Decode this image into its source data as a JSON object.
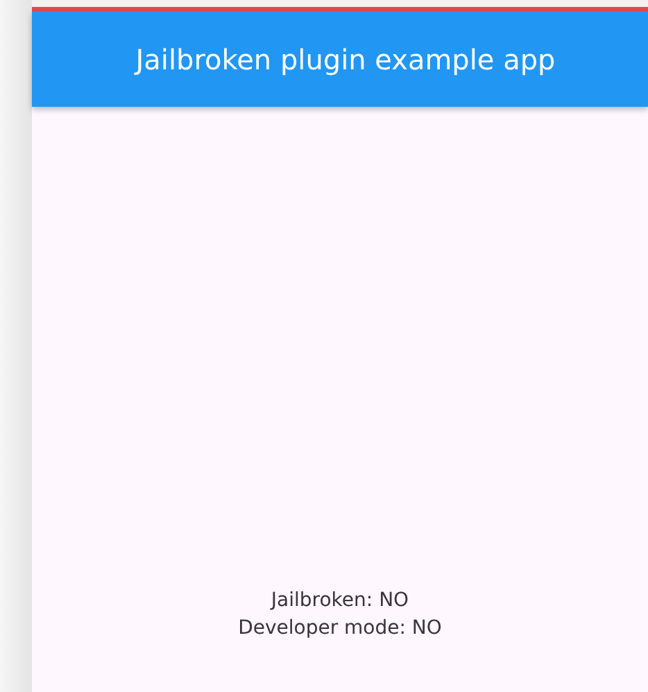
{
  "app_bar": {
    "title": "Jailbroken plugin example app"
  },
  "status_lines": [
    "Jailbroken: NO",
    "Developer mode: NO"
  ]
}
